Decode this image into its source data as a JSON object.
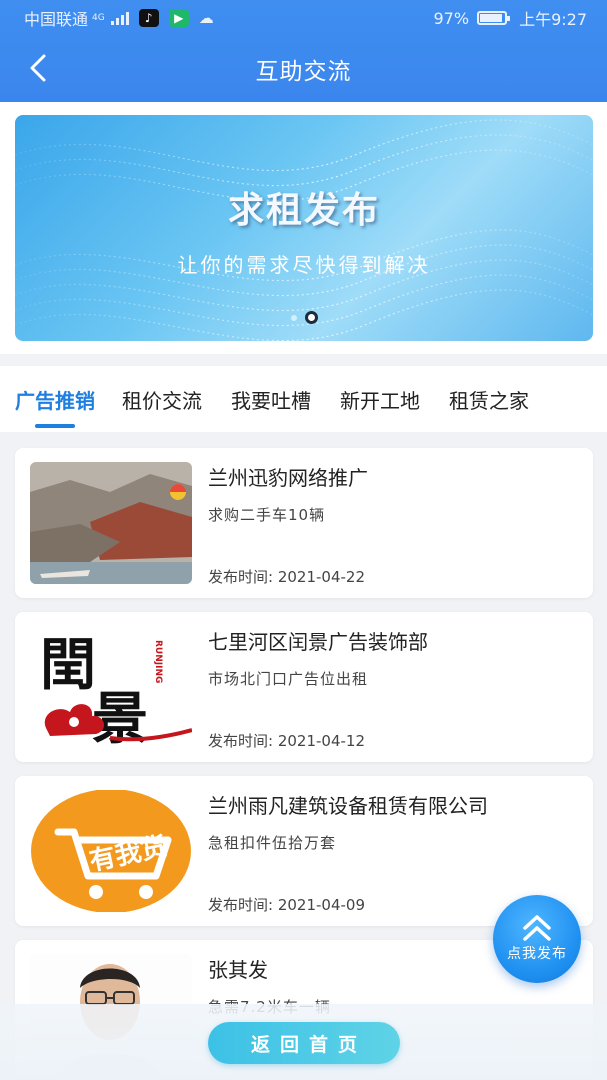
{
  "status_bar": {
    "carrier": "中国联通",
    "network": "4G",
    "battery": "97%",
    "time": "上午9:27"
  },
  "header": {
    "title": "互助交流",
    "back_icon": "chevron-left-icon"
  },
  "banner": {
    "title": "求租发布",
    "subtitle": "让你的需求尽快得到解决",
    "slide_count": 2,
    "active_slide": 2
  },
  "tabs": [
    {
      "label": "广告推销",
      "active": true
    },
    {
      "label": "租价交流",
      "active": false
    },
    {
      "label": "我要吐槽",
      "active": false
    },
    {
      "label": "新开工地",
      "active": false
    },
    {
      "label": "租赁之家",
      "active": false
    }
  ],
  "posts": [
    {
      "title": "兰州迅豹网络推广",
      "desc": "求购二手车10辆",
      "date": "发布时间: 2021-04-22",
      "thumb": "landscape-photo"
    },
    {
      "title": "七里河区闰景广告装饰部",
      "desc": "市场北门口广告位出租",
      "date": "发布时间: 2021-04-12",
      "thumb": "calligraphy-logo",
      "logo_text": "閏景",
      "logo_side_text": "RUNJING"
    },
    {
      "title": "兰州雨凡建筑设备租赁有限公司",
      "desc": "急租扣件伍拾万套",
      "date": "发布时间: 2021-04-09",
      "thumb": "shopping-cart-logo",
      "logo_text": "有我货"
    },
    {
      "title": "张其发",
      "desc": "急需7.2米车一辆",
      "date": "",
      "thumb": "person-photo"
    }
  ],
  "fab": {
    "label": "点我发布",
    "icon": "double-chevron-up-icon"
  },
  "home_button": {
    "label": "返回首页"
  },
  "colors": {
    "header": "#3b86ee",
    "active_tab": "#1e7fe0",
    "fab": "#1e8ff0",
    "home_button": "#4cc8e6"
  }
}
